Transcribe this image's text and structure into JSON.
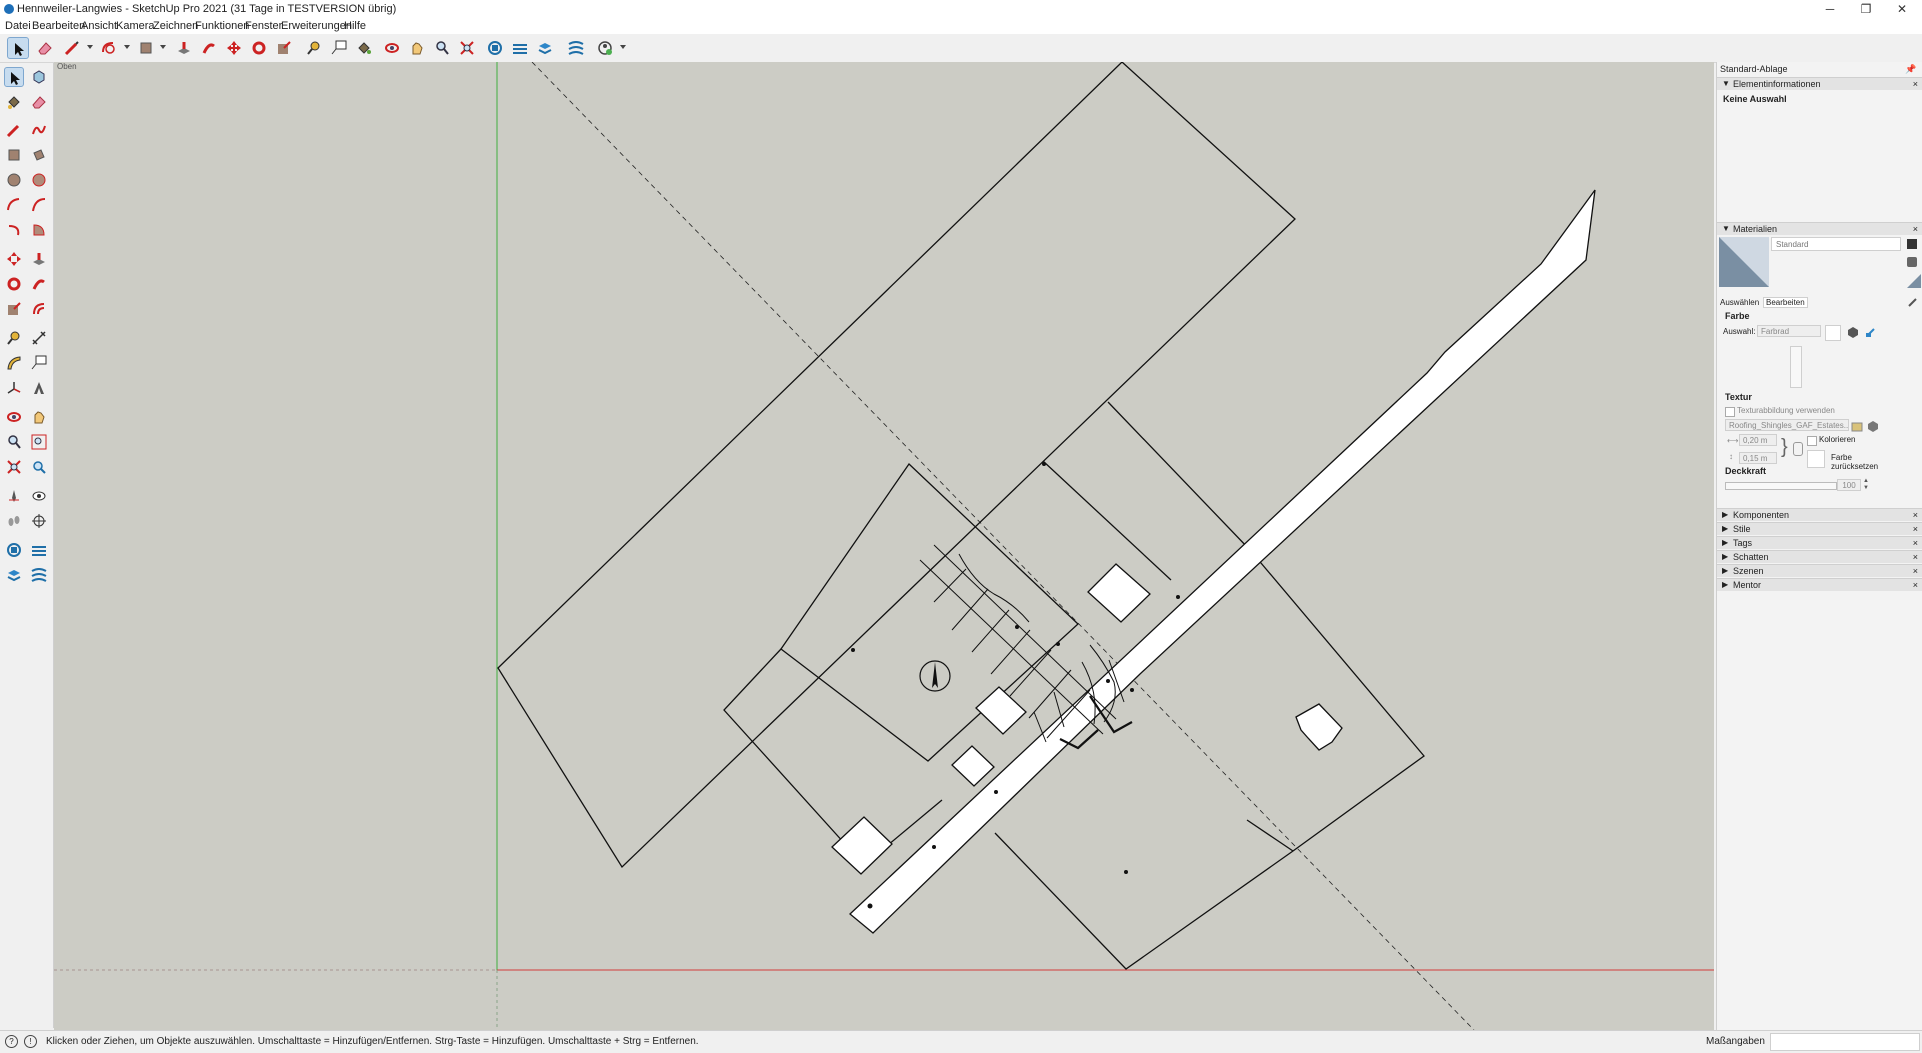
{
  "window": {
    "title": "Hennweiler-Langwies - SketchUp Pro 2021 (31 Tage in TESTVERSION übrig)",
    "minimize_glyph": "─",
    "maximize_glyph": "❐",
    "close_glyph": "✕"
  },
  "menu": {
    "items": [
      "Datei",
      "Bearbeiten",
      "Ansicht",
      "Kamera",
      "Zeichnen",
      "Funktionen",
      "Fenster",
      "Erweiterungen",
      "Hilfe"
    ]
  },
  "toolbar": {
    "icons": [
      "select-icon",
      "eraser-icon",
      "pencil-line-icon",
      "arc-icon",
      "rectangle-icon",
      "push-pull-icon",
      "follow-me-icon",
      "move-icon",
      "rotate-icon",
      "scale-icon",
      "tape-measure-icon",
      "text-label-icon",
      "paint-bucket-icon",
      "orbit-icon",
      "pan-icon",
      "zoom-icon",
      "zoom-extents-icon",
      "warehouse-icon",
      "extension-warehouse-icon",
      "layout-icon",
      "sandbox-icon",
      "account-icon"
    ]
  },
  "viewport": {
    "view_label": "Oben",
    "background_color": "#ccccc5",
    "axis_green": "#3fae3f",
    "axis_red": "#d23c3c"
  },
  "right_panel": {
    "tray_title": "Standard-Ablage",
    "entity_info": {
      "title": "Elementinformationen",
      "selection_text": "Keine Auswahl"
    },
    "materials": {
      "title": "Materialien",
      "material_name": "Standard",
      "tab_select": "Auswählen",
      "tab_edit": "Bearbeiten",
      "color_heading": "Farbe",
      "picker_label": "Auswahl:",
      "picker_value": "Farbrad",
      "texture_heading": "Textur",
      "use_texture_label": "Texturabbildung verwenden",
      "texture_file": "Roofing_Shingles_GAF_Estates...",
      "width_value": "0,20 m",
      "height_value": "0,15 m",
      "colorize_label": "Kolorieren",
      "reset_color_label_1": "Farbe",
      "reset_color_label_2": "zurücksetzen",
      "opacity_heading": "Deckkraft",
      "opacity_value": "100"
    },
    "collapsed_panels": [
      "Komponenten",
      "Stile",
      "Tags",
      "Schatten",
      "Szenen",
      "Mentor"
    ]
  },
  "status": {
    "message": "Klicken oder Ziehen, um Objekte auszuwählen. Umschalttaste = Hinzufügen/Entfernen. Strg-Taste = Hinzufügen. Umschalttaste + Strg = Entfernen.",
    "measurements_label": "Maßangaben",
    "measurements_value": ""
  }
}
